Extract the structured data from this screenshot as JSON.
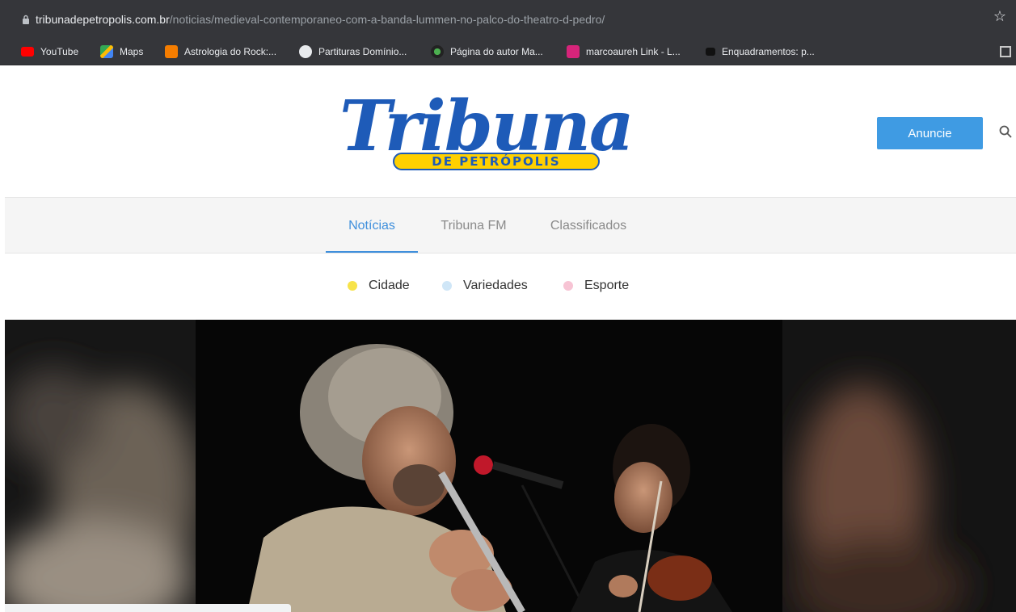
{
  "browser": {
    "url_host": "tribunadepetropolis.com.br",
    "url_path": "/noticias/medieval-contemporaneo-com-a-banda-lummen-no-palco-do-theatro-d-pedro/",
    "bookmarks": [
      {
        "label": "YouTube",
        "icon": "youtube-icon",
        "color": "#ff0000"
      },
      {
        "label": "Maps",
        "icon": "maps-icon",
        "color": "#34a853"
      },
      {
        "label": "Astrologia do Rock:...",
        "icon": "blogger-icon",
        "color": "#f57d00"
      },
      {
        "label": "Partituras Domínio...",
        "icon": "globe-icon",
        "color": "#e8eaed"
      },
      {
        "label": "Página do autor Ma...",
        "icon": "site-icon",
        "color": "#4caf50"
      },
      {
        "label": "marcoaureh Link - L...",
        "icon": "linktree-icon",
        "color": "#d6247a"
      },
      {
        "label": "Enquadramentos: p...",
        "icon": "clapper-icon",
        "color": "#222222"
      }
    ]
  },
  "header": {
    "logo_word": "Tribuna",
    "logo_band": "DE PETRÓPOLIS",
    "cta_label": "Anuncie"
  },
  "nav": {
    "items": [
      {
        "label": "Notícias",
        "active": true
      },
      {
        "label": "Tribuna FM",
        "active": false
      },
      {
        "label": "Classificados",
        "active": false
      }
    ]
  },
  "categories": [
    {
      "label": "Cidade",
      "color": "#f7e34a"
    },
    {
      "label": "Variedades",
      "color": "#cfe6f7"
    },
    {
      "label": "Esporte",
      "color": "#f7c4d4"
    }
  ],
  "colors": {
    "accent": "#3f9be3",
    "logo_blue": "#1e5bb8",
    "logo_yellow": "#ffd000"
  }
}
